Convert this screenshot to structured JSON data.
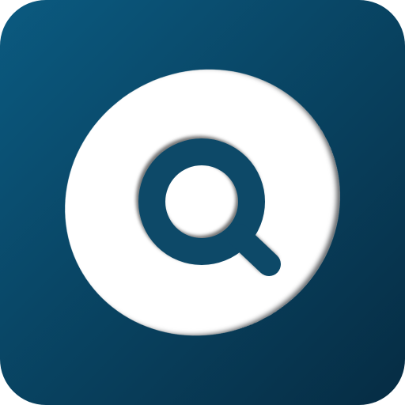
{
  "app_icon": {
    "icon_name": "search-magnifier-icon",
    "colors": {
      "background_top": "#0b5a80",
      "background_bottom": "#062c43",
      "disc": "#ffffff",
      "glyph": "#0f4868",
      "shadow": "#041d2c"
    }
  }
}
